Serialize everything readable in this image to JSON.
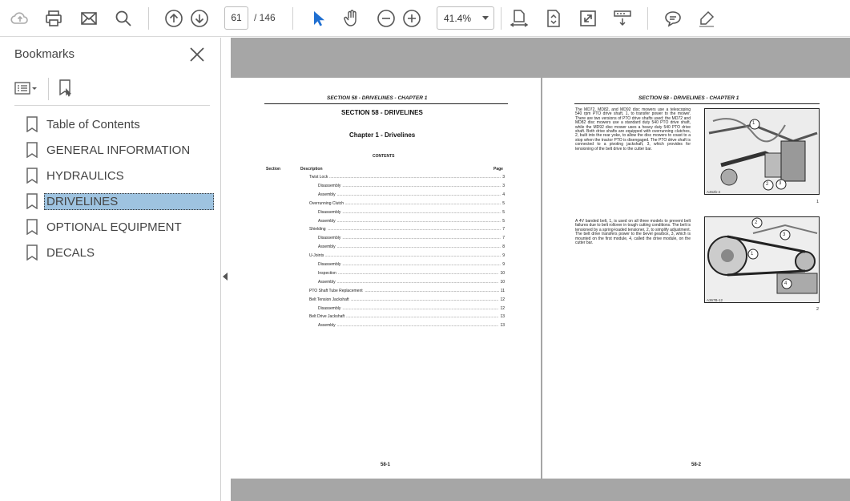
{
  "toolbar": {
    "page_current": "61",
    "page_total": "/ 146",
    "zoom": "41.4%"
  },
  "sidebar": {
    "title": "Bookmarks",
    "items": [
      {
        "label": "Table of Contents"
      },
      {
        "label": "GENERAL INFORMATION"
      },
      {
        "label": "HYDRAULICS"
      },
      {
        "label": "DRIVELINES",
        "selected": true
      },
      {
        "label": "OPTIONAL EQUIPMENT"
      },
      {
        "label": "DECALS"
      }
    ]
  },
  "colors": {
    "selected_bg": "#9ec3e0",
    "doc_bg": "#a6a6a6",
    "cursor_blue": "#1f6fd1"
  },
  "page_left": {
    "header": "SECTION 58 - DRIVELINES - CHAPTER 1",
    "section_title": "SECTION 58 - DRIVELINES",
    "chapter_title": "Chapter 1 - Drivelines",
    "contents_label": "CONTENTS",
    "col_section": "Section",
    "col_description": "Description",
    "col_page": "Page",
    "toc": [
      {
        "text": "Twist Lock",
        "page": "3",
        "indent": 0
      },
      {
        "text": "Disassembly",
        "page": "3",
        "indent": 1
      },
      {
        "text": "Assembly",
        "page": "4",
        "indent": 1
      },
      {
        "text": "Overrunning Clutch",
        "page": "5",
        "indent": 0
      },
      {
        "text": "Disassembly",
        "page": "5",
        "indent": 1
      },
      {
        "text": "Assembly",
        "page": "5",
        "indent": 1
      },
      {
        "text": "Shielding",
        "page": "7",
        "indent": 0
      },
      {
        "text": "Disassembly",
        "page": "7",
        "indent": 1
      },
      {
        "text": "Assembly",
        "page": "8",
        "indent": 1
      },
      {
        "text": "U-Joints",
        "page": "9",
        "indent": 0
      },
      {
        "text": "Disassembly",
        "page": "9",
        "indent": 1
      },
      {
        "text": "Inspection",
        "page": "10",
        "indent": 1
      },
      {
        "text": "Assembly",
        "page": "10",
        "indent": 1
      },
      {
        "text": "PTO Shaft Tube Replacement",
        "page": "11",
        "indent": 0
      },
      {
        "text": "Belt Tension Jackshaft",
        "page": "12",
        "indent": 0
      },
      {
        "text": "Disassembly",
        "page": "12",
        "indent": 1
      },
      {
        "text": "Belt Drive Jackshaft",
        "page": "13",
        "indent": 0
      },
      {
        "text": "Assembly",
        "page": "13",
        "indent": 1
      }
    ],
    "footer": "58-1"
  },
  "page_right": {
    "header": "SECTION 58 - DRIVELINES - CHAPTER 1",
    "para1": "The MD72, MD82, and MD92 disc mowers use a telescoping 540 rpm PTO drive shaft, 1, to transfer power to the mower. There are two versions of PTO drive shafts used; the MD72 and MD82 disc mowers use a standard duty 540 PTO drive shaft, while the MD92 disc mower uses a heavy duty 540 PTO drive shaft. Both drive shafts are equipped with overrunning clutches, 2, built into the rear yoke, to allow the disc mowers to coast to a stop when the tractor PTO is disengaged. The PTO drive shaft is connected to a pivoting jackshaft, 3, which provides for tensioning of the belt drive to the cutter bar.",
    "para2": "A 4V banded belt, 1, is used on all three models to prevent belt failures due to belt rollover in tough cutting conditions. The belt is tensioned by a spring-loaded tensioner, 2, to simplify adjustment. The belt drive transfers power to the bevel gearbox, 3, which is mounted on the first module, 4, called the drive module, on the cutter bar.",
    "fig1_caption": "A462b-4",
    "fig1_num": "1",
    "fig2_caption": "A367B-12",
    "fig2_num": "2",
    "fig1_callouts": [
      "1",
      "2",
      "3"
    ],
    "fig2_callouts": [
      "1",
      "2",
      "3",
      "4"
    ],
    "footer": "58-2"
  }
}
